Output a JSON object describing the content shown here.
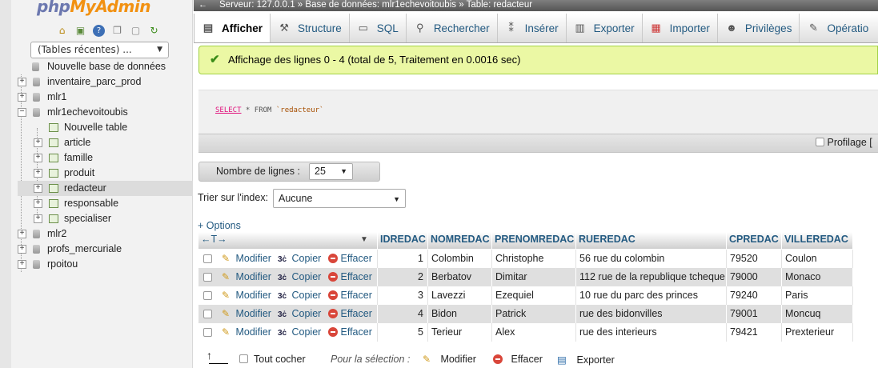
{
  "nav": {
    "logo_php": "php",
    "logo_admin": "MyAdmin",
    "recent": "(Tables récentes) ...",
    "tree": [
      {
        "label": "Nouvelle base de données",
        "type": "new-db",
        "level": 0
      },
      {
        "label": "inventaire_parc_prod",
        "type": "db",
        "level": 0
      },
      {
        "label": "mlr1",
        "type": "db",
        "level": 0
      },
      {
        "label": "mlr1echevoitoubis",
        "type": "db-open",
        "level": 0
      },
      {
        "label": "Nouvelle table",
        "type": "new-table",
        "level": 1
      },
      {
        "label": "article",
        "type": "table",
        "level": 1
      },
      {
        "label": "famille",
        "type": "table",
        "level": 1
      },
      {
        "label": "produit",
        "type": "table",
        "level": 1
      },
      {
        "label": "redacteur",
        "type": "table",
        "level": 1,
        "selected": true
      },
      {
        "label": "responsable",
        "type": "table",
        "level": 1
      },
      {
        "label": "specialiser",
        "type": "table",
        "level": 1
      },
      {
        "label": "mlr2",
        "type": "db",
        "level": 0
      },
      {
        "label": "profs_mercuriale",
        "type": "db",
        "level": 0
      },
      {
        "label": "rpoitou",
        "type": "db",
        "level": 0
      }
    ]
  },
  "breadcrumb": {
    "text": "Serveur: 127.0.0.1 » Base de données: mlr1echevoitoubis » Table: redacteur"
  },
  "tabs": [
    {
      "label": "Afficher",
      "icon": "browse-icon",
      "active": true
    },
    {
      "label": "Structure",
      "icon": "structure-icon"
    },
    {
      "label": "SQL",
      "icon": "sql-icon"
    },
    {
      "label": "Rechercher",
      "icon": "search-icon"
    },
    {
      "label": "Insérer",
      "icon": "insert-icon"
    },
    {
      "label": "Exporter",
      "icon": "export-icon"
    },
    {
      "label": "Importer",
      "icon": "import-icon"
    },
    {
      "label": "Privilèges",
      "icon": "privileges-icon"
    },
    {
      "label": "Opératio",
      "icon": "operations-icon"
    }
  ],
  "message": "Affichage des lignes 0 - 4 (total de 5, Traitement en 0.0016 sec)",
  "sql": {
    "keyword": "SELECT",
    "rest": " * FROM ",
    "table": "`redacteur`"
  },
  "profiling_label": "Profilage [",
  "nrows": {
    "label": "Nombre de lignes :",
    "value": "25"
  },
  "sort": {
    "label": "Trier sur l'index:",
    "value": "Aucune"
  },
  "options_label": "+ Options",
  "table": {
    "columns": [
      "IDREDAC",
      "NOMREDAC",
      "PRENOMREDAC",
      "RUEREDAC",
      "CPREDAC",
      "VILLEREDAC"
    ],
    "actions": {
      "edit": "Modifier",
      "copy": "Copier",
      "delete": "Effacer"
    },
    "rows": [
      [
        "1",
        "Colombin",
        "Christophe",
        "56 rue du colombin",
        "79520",
        "Coulon"
      ],
      [
        "2",
        "Berbatov",
        "Dimitar",
        "112 rue de la republique tcheque",
        "79000",
        "Monaco"
      ],
      [
        "3",
        "Lavezzi",
        "Ezequiel",
        "10 rue du parc des princes",
        "79240",
        "Paris"
      ],
      [
        "4",
        "Bidon",
        "Patrick",
        "rue des bidonvilles",
        "79001",
        "Moncuq"
      ],
      [
        "5",
        "Terieur",
        "Alex",
        "rue des interieurs",
        "79421",
        "Prexterieur"
      ]
    ]
  },
  "bottom": {
    "check_all": "Tout cocher",
    "with_selected": "Pour la sélection :",
    "edit": "Modifier",
    "delete": "Effacer",
    "export": "Exporter"
  }
}
